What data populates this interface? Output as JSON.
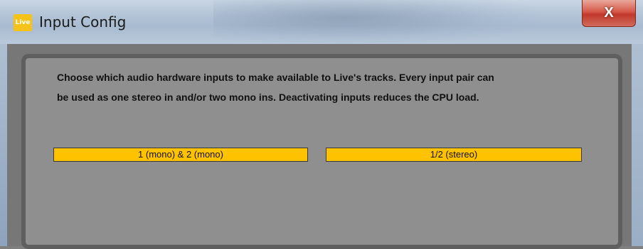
{
  "window": {
    "app_logo_text": "Live",
    "title": "Input Config",
    "close_label": "X"
  },
  "description": {
    "line1": "Choose which audio hardware inputs to make available to Live's tracks. Every input pair can",
    "line2": "be used as one stereo in and/or two mono ins.  Deactivating inputs reduces the CPU load."
  },
  "inputs": [
    {
      "label": "1 (mono) & 2 (mono)",
      "active": true
    },
    {
      "label": "1/2 (stereo)",
      "active": true
    }
  ],
  "colors": {
    "active_input": "#ffc200",
    "panel": "#8f8f8f",
    "app_logo": "#f5c21a",
    "close_button": "#c0392b"
  },
  "icons": {
    "app_logo": "ableton-live-logo-icon",
    "close": "close-icon"
  }
}
